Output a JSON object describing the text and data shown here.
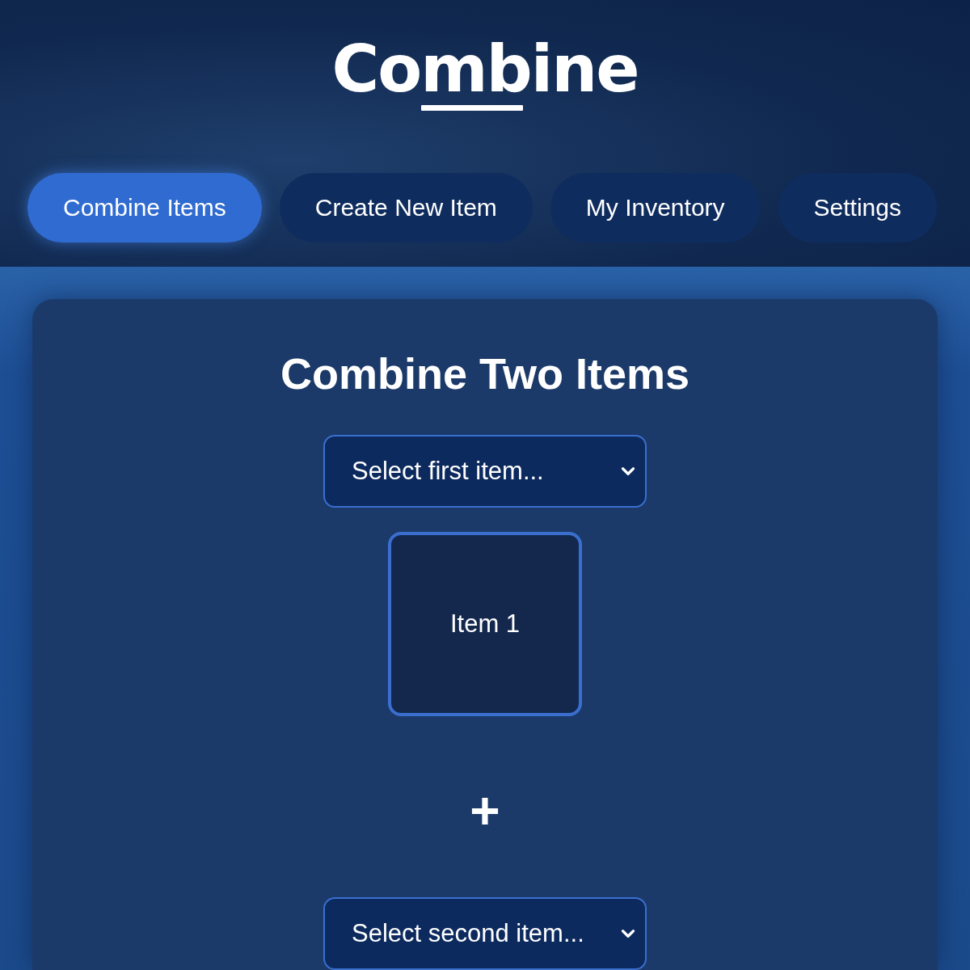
{
  "logo": {
    "text": "Combine"
  },
  "tabs": [
    {
      "label": "Combine Items",
      "selected": true
    },
    {
      "label": "Create New Item",
      "selected": false
    },
    {
      "label": "My Inventory",
      "selected": false
    },
    {
      "label": "Settings",
      "selected": false
    }
  ],
  "panel": {
    "title": "Combine Two Items",
    "first_select": {
      "placeholder": "Select first item..."
    },
    "first_slot": {
      "label": "Item 1"
    },
    "operator": "+",
    "second_select": {
      "placeholder": "Select second item..."
    }
  }
}
